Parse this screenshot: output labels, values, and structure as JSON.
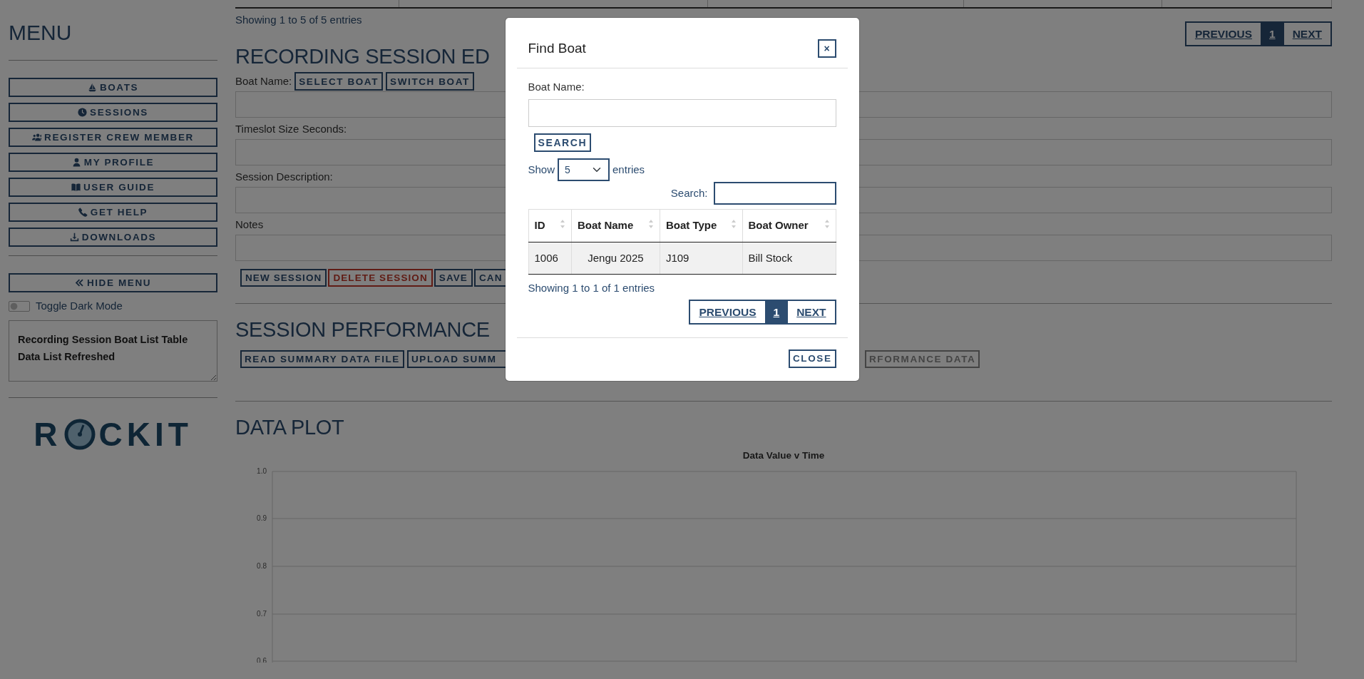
{
  "sidebar": {
    "title": "MENU",
    "nav_buttons": [
      {
        "label": "BOATS"
      },
      {
        "label": "SESSIONS"
      },
      {
        "label": "REGISTER CREW MEMBER"
      },
      {
        "label": "MY PROFILE"
      },
      {
        "label": "USER GUIDE"
      },
      {
        "label": "GET HELP"
      },
      {
        "label": "DOWNLOADS"
      }
    ],
    "hide_menu": "HIDE MENU",
    "dark_mode": {
      "label": "Toggle Dark Mode",
      "on": false
    },
    "status_log": "Recording Session Boat List Table\nData List Refreshed",
    "logo": {
      "parts": [
        "R",
        "CKIT"
      ]
    }
  },
  "main": {
    "previous_table": {
      "info": "Showing 1 to 5 of 5 entries",
      "pagination": {
        "previous": "PREVIOUS",
        "pages": [
          {
            "label": "1",
            "selected": true
          }
        ],
        "next": "NEXT"
      }
    },
    "editor": {
      "title": "RECORDING SESSION ED",
      "fields": [
        {
          "label": "Boat Name:",
          "buttons": [
            "SELECT BOAT",
            "SWITCH BOAT"
          ]
        },
        {
          "label": "Timeslot Size Seconds:"
        },
        {
          "label": "Session Description:"
        },
        {
          "label": "Notes"
        }
      ],
      "actions": [
        {
          "label": "NEW SESSION",
          "kind": "default"
        },
        {
          "label": "DELETE SESSION",
          "kind": "danger"
        },
        {
          "label": "SAVE",
          "kind": "default"
        },
        {
          "label": "CAN",
          "kind": "default"
        }
      ]
    },
    "performance": {
      "title": "SESSION PERFORMANCE",
      "actions": [
        {
          "label": "READ SUMMARY DATA FILE",
          "disabled": false
        },
        {
          "label": "UPLOAD SUMM",
          "disabled": false
        },
        {
          "label": "RFORMANCE DATA",
          "disabled": true
        }
      ]
    },
    "data_plot": {
      "title": "DATA PLOT",
      "chart_data": {
        "type": "line",
        "categories": [
          null,
          null
        ],
        "ylim": [
          0.6,
          1.0
        ],
        "grid": true,
        "title": "Data Value v Time",
        "yticks": [
          {
            "value": 1.0,
            "label": "1.0"
          },
          {
            "value": 0.9,
            "label": "0.9"
          },
          {
            "value": 0.8,
            "label": "0.8"
          },
          {
            "value": 0.7,
            "label": "0.7"
          },
          {
            "value": 0.6,
            "label": "0.6"
          }
        ]
      }
    }
  },
  "modal": {
    "title": "Find Boat",
    "close_icon": "×",
    "boat_label": "Boat Name:",
    "search_button": "SEARCH",
    "length": {
      "before": "Show",
      "value": "5",
      "after": "entries"
    },
    "filter_label": "Search:",
    "table": {
      "columns": [
        "ID",
        "Boat Name",
        "Boat Type",
        "Boat Owner"
      ],
      "rows": [
        [
          "1006",
          "Jengu 2025",
          "J109",
          "Bill Stock"
        ]
      ]
    },
    "info": "Showing 1 to 1 of 1 entries",
    "pagination": {
      "previous": "PREVIOUS",
      "pages": [
        {
          "label": "1",
          "selected": true
        }
      ],
      "next": "NEXT"
    },
    "close_button": "CLOSE"
  }
}
